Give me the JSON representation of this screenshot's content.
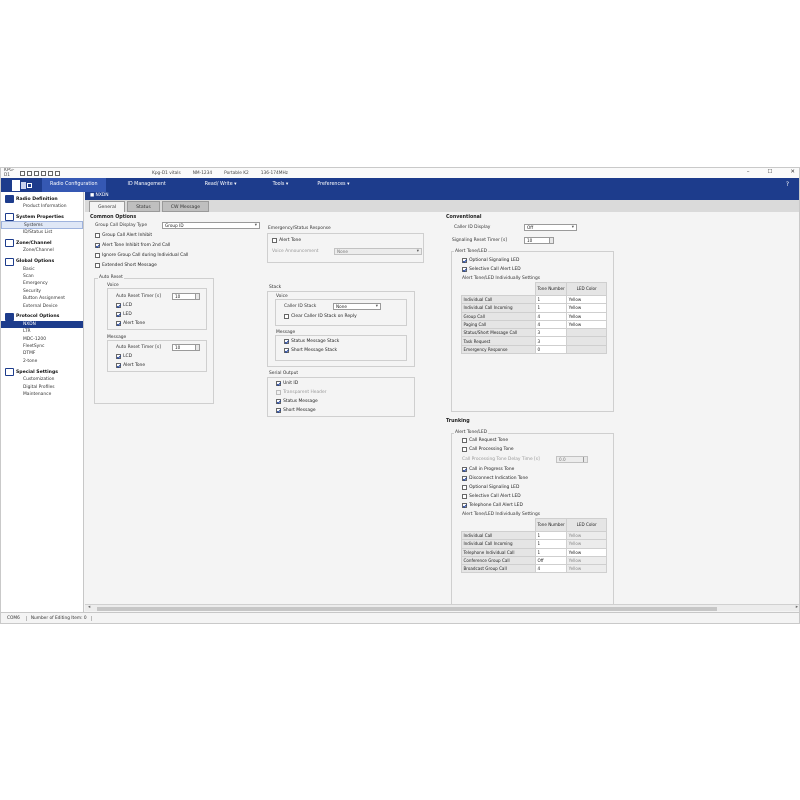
{
  "titlebar": {
    "app_name": "KPG-D1",
    "model": "Kpg-D1 vitals",
    "fw": "NM-1234",
    "mode": "Portable K2",
    "freq": "136-174MHz",
    "window_buttons": [
      "–",
      "☐",
      "✕"
    ]
  },
  "menubar": {
    "items": [
      "Radio Configuration",
      "ID Management",
      "Read/ Write ▾",
      "Tools ▾",
      "Preferences ▾"
    ],
    "help": "?"
  },
  "sidebar": {
    "groups": [
      {
        "label": "Radio Definition",
        "items": [
          "Product Information"
        ]
      },
      {
        "label": "System Properties",
        "items": [
          "Systems",
          "ID/Status List"
        ]
      },
      {
        "label": "Zone/Channel",
        "items": [
          "Zone/Channel"
        ]
      },
      {
        "label": "Global Options",
        "items": [
          "Basic",
          "Scan",
          "Emergency",
          "Security",
          "Button Assignment",
          "External Device"
        ]
      },
      {
        "label": "Protocol Options",
        "items": [
          "NXDN",
          "LTR",
          "MDC-1200",
          "FleetSync",
          "DTMF",
          "2-tone"
        ]
      },
      {
        "label": "Special Settings",
        "items": [
          "Customization",
          "Digital Profiles",
          "Maintenance"
        ]
      }
    ]
  },
  "content": {
    "title": "■ NXDN",
    "tabs": [
      "General",
      "Status",
      "CW Message"
    ]
  },
  "common": {
    "title": "Common Options",
    "group_call_display_label": "Group Call Display Type",
    "group_call_display_value": "Group ID",
    "checks": [
      "Group Call Alert Inhibit",
      "Alert Tone Inhibit from 2nd Call",
      "Ignore Group Call during Individual Call",
      "Extended Short Message"
    ],
    "auto_reset_title": "Auto Reset",
    "voice_title": "Voice",
    "timer_label": "Auto Reset Timer [s]",
    "voice_timer": "10",
    "lcd": "LCD",
    "led": "LED",
    "alert_tone": "Alert Tone",
    "message_title": "Message",
    "message_timer": "10"
  },
  "emergency": {
    "title": "Emergency/Status Response",
    "alert_tone": "Alert Tone",
    "voice_announcement_label": "Voice Announcement",
    "voice_announcement_value": "None",
    "stack_title": "Stack",
    "voice_title": "Voice",
    "caller_id_stack_label": "Caller ID Stack",
    "caller_id_stack_value": "None",
    "clear_caller_id": "Clear Caller ID Stack on Reply",
    "message_title": "Message",
    "status_message_stack": "Status Message Stack",
    "short_message_stack": "Short Message Stack",
    "serial_output_title": "Serial Output",
    "serial_items": [
      "Unit ID",
      "Transparent Header",
      "Status Message",
      "Short Message"
    ]
  },
  "conventional": {
    "title": "Conventional",
    "caller_id_display_label": "Caller ID Display",
    "caller_id_display_value": "Off",
    "signaling_reset_label": "Signaling Reset Timer [s]",
    "signaling_reset_value": "10",
    "alert_title": "Alert Tone/LED",
    "optional_signaling_led": "Optional Signaling LED",
    "selective_call_alert_led": "Selective Call Alert LED",
    "individual_title": "Alert Tone/LED Individually Settings",
    "headers": [
      "Tone Number",
      "LED Color"
    ],
    "rows": [
      {
        "name": "Individual Call",
        "tone": "1",
        "led": "Yellow"
      },
      {
        "name": "Individual Call Incoming",
        "tone": "1",
        "led": "Yellow"
      },
      {
        "name": "Group Call",
        "tone": "4",
        "led": "Yellow"
      },
      {
        "name": "Paging Call",
        "tone": "4",
        "led": "Yellow"
      },
      {
        "name": "Status/Short Message Call",
        "tone": "3",
        "led": ""
      },
      {
        "name": "Task Request",
        "tone": "3",
        "led": ""
      },
      {
        "name": "Emergency Response",
        "tone": "0",
        "led": ""
      }
    ]
  },
  "trunking": {
    "title": "Trunking",
    "alert_title": "Alert Tone/LED",
    "checks": [
      "Call Request Tone",
      "Call Processing Tone"
    ],
    "delay_label": "Call Processing Tone Delay Time [s]",
    "delay_value": "0.0",
    "checks2": [
      "Call in Progress Tone",
      "Disconnect Indication Tone",
      "Optional Signaling LED",
      "Selective Call Alert LED",
      "Telephone Call Alert LED"
    ],
    "individual_title": "Alert Tone/LED Individually Settings",
    "headers": [
      "Tone Number",
      "LED Color"
    ],
    "rows": [
      {
        "name": "Individual Call",
        "tone": "1",
        "led": "Yellow"
      },
      {
        "name": "Individual Call Incoming",
        "tone": "1",
        "led": "Yellow"
      },
      {
        "name": "Telephone Individual Call",
        "tone": "1",
        "led": "Yellow"
      },
      {
        "name": "Conference Group Call",
        "tone": "Off",
        "led": "Yellow"
      },
      {
        "name": "Broadcast Group Call",
        "tone": "4",
        "led": "Yellow"
      },
      {
        "name": "Telephone Group Call",
        "tone": "4",
        "led": "Yellow"
      }
    ]
  },
  "status": {
    "port": "COM6",
    "editing": "Number of Editing Item: 0"
  }
}
